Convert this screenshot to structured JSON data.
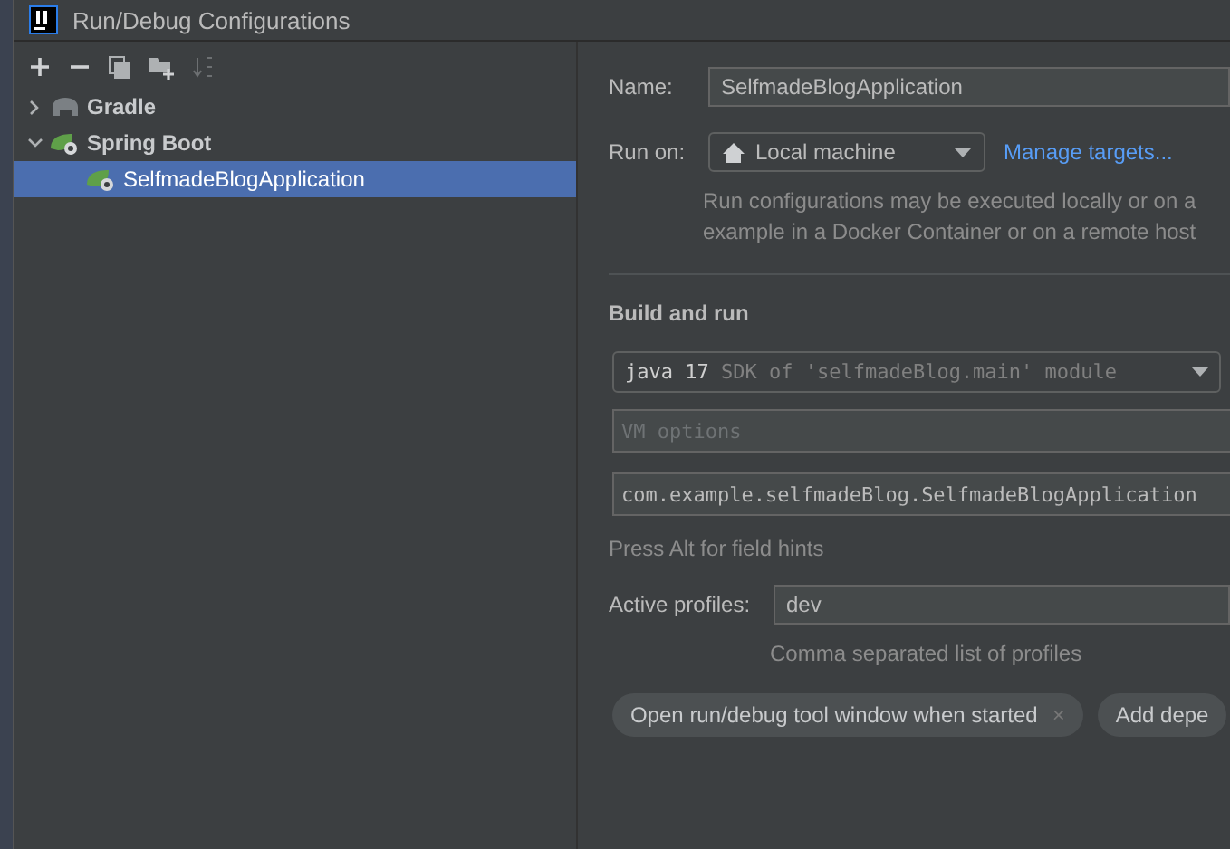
{
  "window": {
    "title": "Run/Debug Configurations"
  },
  "tree": [
    {
      "label": "Gradle",
      "kind": "gradle",
      "expanded": false,
      "selected": false
    },
    {
      "label": "Spring Boot",
      "kind": "spring",
      "expanded": true,
      "selected": false,
      "children": [
        {
          "label": "SelfmadeBlogApplication",
          "kind": "spring",
          "selected": true
        }
      ]
    }
  ],
  "form": {
    "name_label": "Name:",
    "name_value": "SelfmadeBlogApplication",
    "run_on_label": "Run on:",
    "run_on_value": "Local machine",
    "manage_link": "Manage targets...",
    "run_on_hint": [
      "Run configurations may be executed locally or on a",
      "example in a Docker Container or on a remote host"
    ],
    "section": "Build and run",
    "sdk_main": "java 17",
    "sdk_detail": "SDK of 'selfmadeBlog.main' module",
    "vm_placeholder": "VM options",
    "main_class": "com.example.selfmadeBlog.SelfmadeBlogApplication",
    "field_hint": "Press Alt for field hints",
    "profiles_label": "Active profiles:",
    "profiles_value": "dev",
    "profiles_hint": "Comma separated list of profiles",
    "chips": [
      {
        "label": "Open run/debug tool window when started",
        "close": "×"
      },
      {
        "label": "Add depe"
      }
    ]
  }
}
